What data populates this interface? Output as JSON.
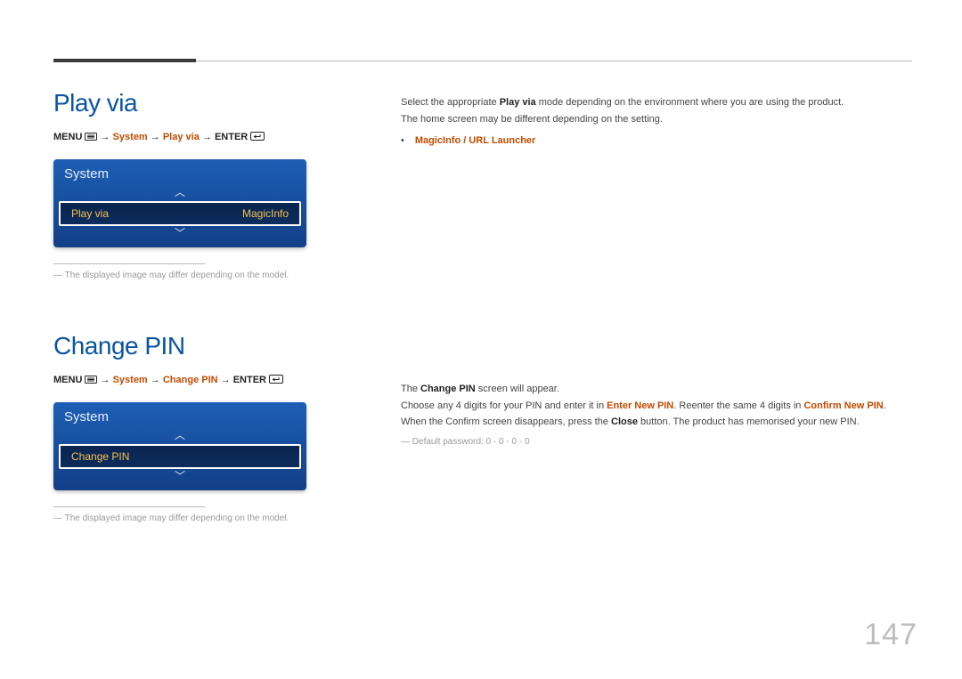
{
  "page_number": "147",
  "playvia": {
    "title": "Play via",
    "path_prefix": "MENU ",
    "path_arrow1": " → ",
    "path_system": "System",
    "path_arrow2": " → ",
    "path_item": "Play via",
    "path_arrow3": " → ",
    "path_enter": "ENTER ",
    "osd_header": "System",
    "osd_item_label": "Play via",
    "osd_item_value": "MagicInfo",
    "footnote": "The displayed image may differ depending on the model.",
    "desc_pre": "Select the appropriate ",
    "desc_bold": "Play via",
    "desc_post": " mode depending on the environment where you are using the product.",
    "desc2": "The home screen may be different depending on the setting.",
    "option": "MagicInfo / URL Launcher"
  },
  "changepin": {
    "title": "Change PIN",
    "path_prefix": "MENU ",
    "path_arrow1": " → ",
    "path_system": "System",
    "path_arrow2": " → ",
    "path_item": "Change PIN",
    "path_arrow3": " → ",
    "path_enter": "ENTER ",
    "osd_header": "System",
    "osd_item_label": "Change PIN",
    "footnote": "The displayed image may differ depending on the model.",
    "p1_pre": "The ",
    "p1_bold": "Change PIN",
    "p1_post": " screen will appear.",
    "p2_pre": "Choose any 4 digits for your PIN and enter it in ",
    "p2_a1": "Enter New PIN",
    "p2_mid": ". Reenter the same 4 digits in ",
    "p2_a2": "Confirm New PIN",
    "p2_post": ".",
    "p3_pre": "When the Confirm screen disappears, press the ",
    "p3_bold": "Close",
    "p3_post": " button. The product has memorised your new PIN.",
    "default_pw": "Default password: 0 - 0 - 0 - 0"
  }
}
